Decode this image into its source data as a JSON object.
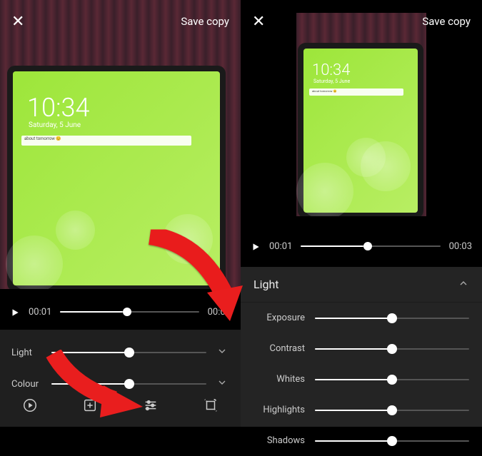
{
  "left": {
    "save_label": "Save copy",
    "tablet_time": "10:34",
    "tablet_date": "Saturday, 5 June",
    "notif": "about tomorrow 😊",
    "playback": {
      "current": "00:01",
      "duration": "00:03"
    },
    "sliders": {
      "light": {
        "label": "Light",
        "pos": 50
      },
      "colour": {
        "label": "Colour",
        "pos": 50
      }
    }
  },
  "right": {
    "save_label": "Save copy",
    "tablet_time": "10:34",
    "tablet_date": "Saturday, 5 June",
    "notif": "about tomorrow 😊",
    "playback": {
      "current": "00:01",
      "duration": "00:03"
    },
    "panel_title": "Light",
    "adjustments": [
      {
        "label": "Exposure",
        "pos": 50
      },
      {
        "label": "Contrast",
        "pos": 50
      },
      {
        "label": "Whites",
        "pos": 50
      },
      {
        "label": "Highlights",
        "pos": 50
      },
      {
        "label": "Shadows",
        "pos": 50
      }
    ]
  }
}
